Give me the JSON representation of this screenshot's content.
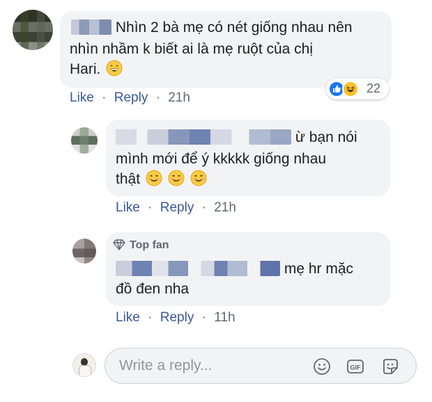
{
  "comment": {
    "text_line1": "Nhìn 2 bà mẹ có nét giống nhau nên",
    "text_line2": "nhìn nhầm k biết ai là mẹ ruột của chị",
    "text_line3": "Hari.",
    "emoji": "grinning-face-icon",
    "reaction_count": "22",
    "actions": {
      "like": "Like",
      "reply": "Reply",
      "separator": "·",
      "time": "21h"
    }
  },
  "reply1": {
    "text_line1": "ừ bạn nói",
    "text_line2": "mình mới để ý kkkkk giống nhau",
    "text_line3": "thật",
    "emojis": [
      "smiling-face-icon",
      "smiling-face-icon",
      "smiling-face-icon"
    ],
    "actions": {
      "like": "Like",
      "reply": "Reply",
      "separator": "·",
      "time": "21h"
    }
  },
  "reply2": {
    "badge": "Top fan",
    "text_line1": "mẹ hr mặc",
    "text_line2": "đồ đen nha",
    "actions": {
      "like": "Like",
      "reply": "Reply",
      "separator": "·",
      "time": "11h"
    }
  },
  "composer": {
    "placeholder": "Write a reply...",
    "tools": [
      "emoji-icon",
      "gif-icon",
      "sticker-icon"
    ]
  },
  "colors": {
    "link": "#385898",
    "bubble": "#f2f3f5",
    "text": "#1c1e21",
    "meta": "#606770"
  }
}
